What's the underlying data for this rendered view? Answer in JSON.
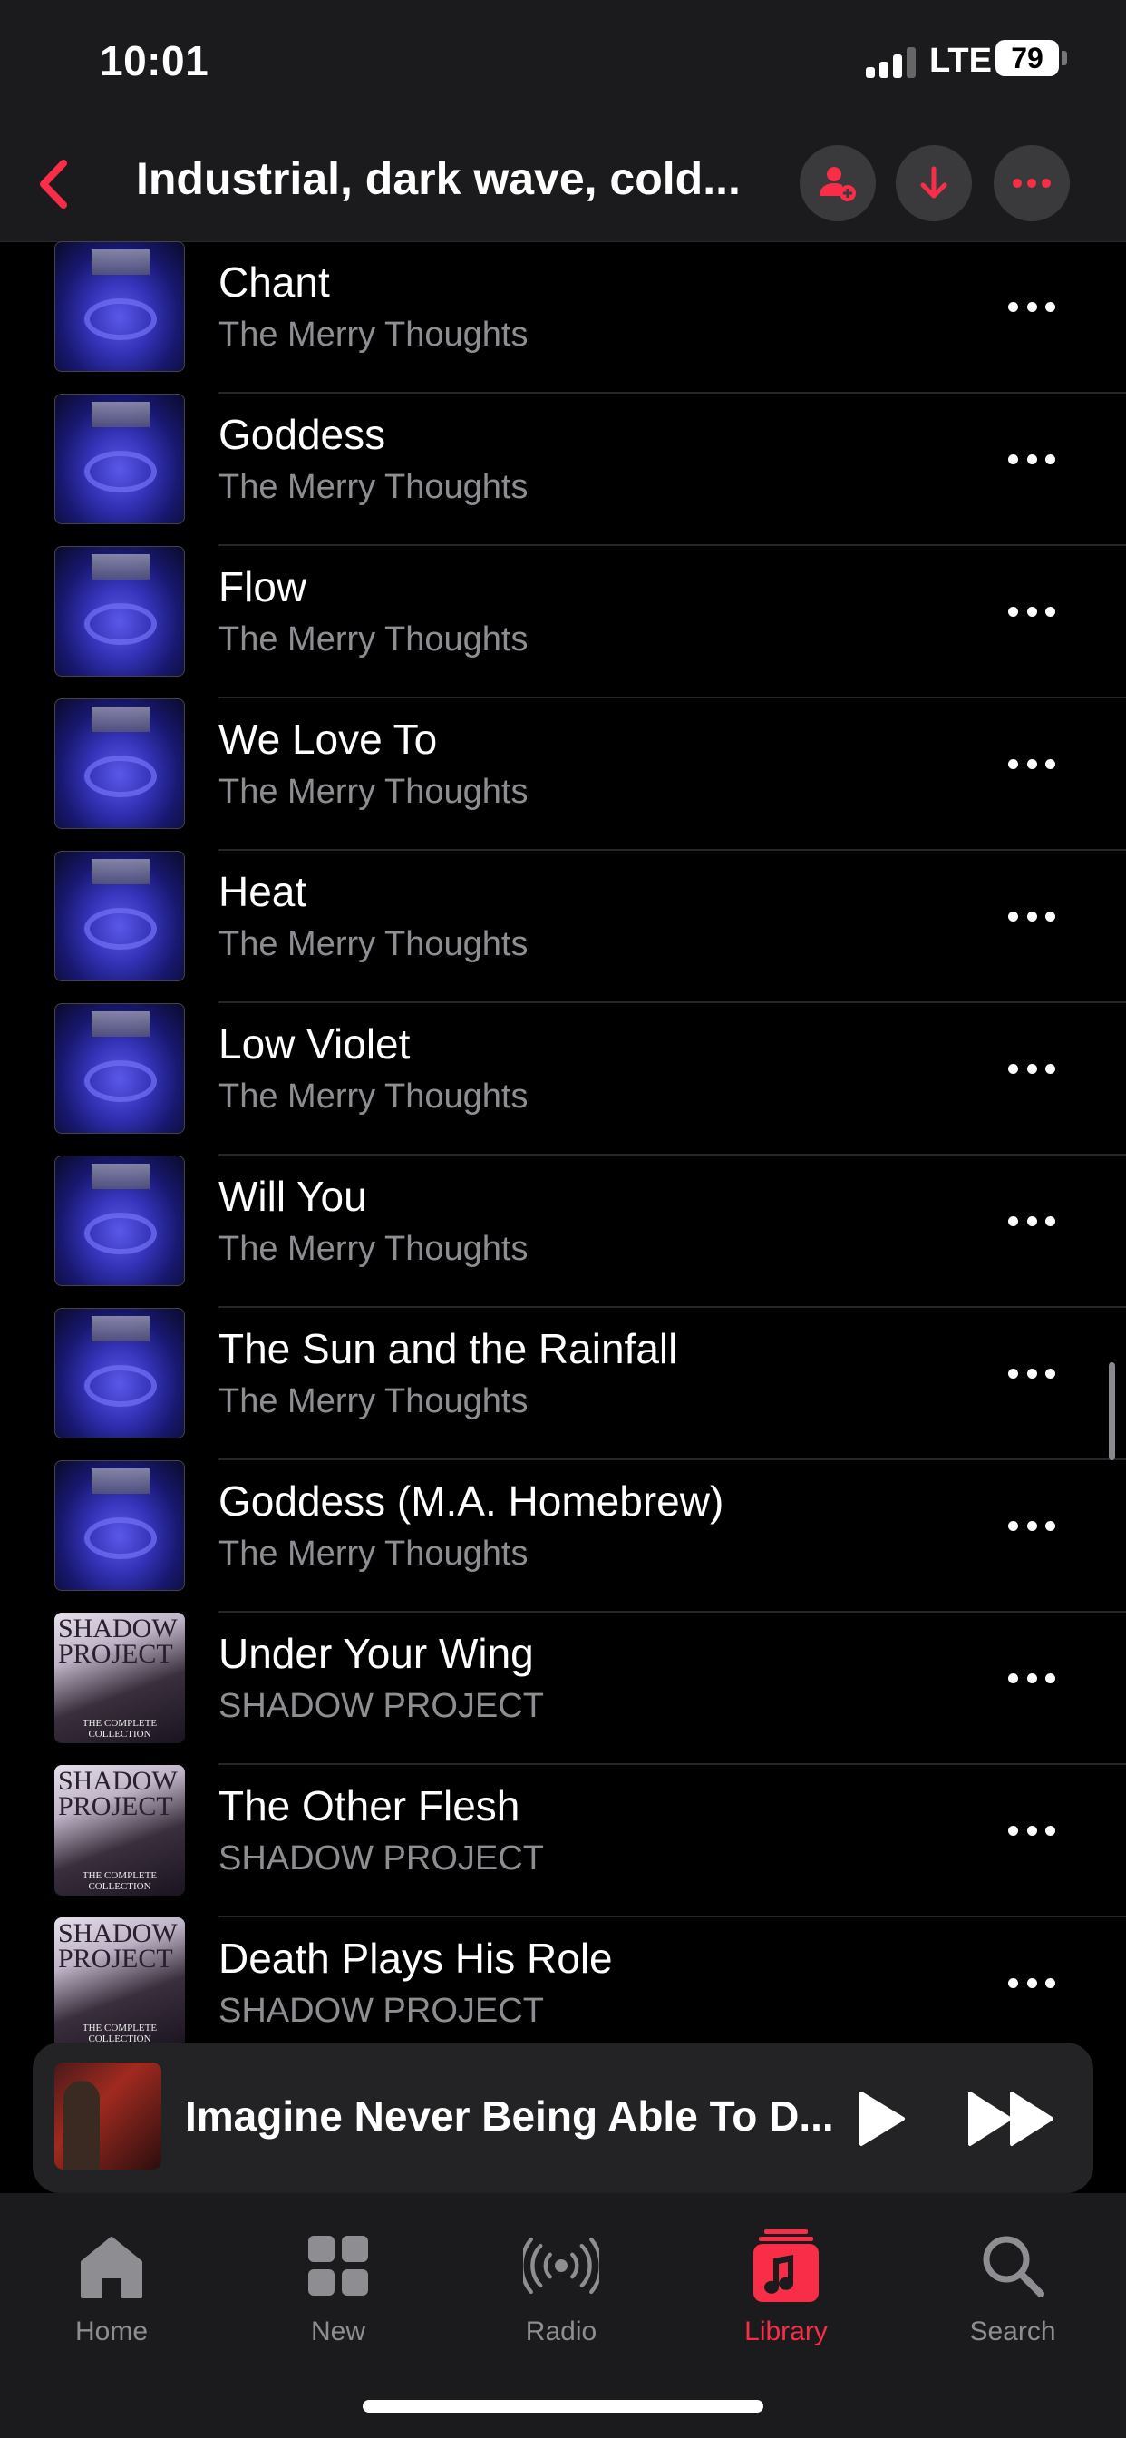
{
  "status_bar": {
    "time": "10:01",
    "network": "LTE",
    "battery": "79"
  },
  "header": {
    "title": "Industrial, dark wave, cold..."
  },
  "songs": [
    {
      "title": "Chant",
      "artist": "The Merry Thoughts"
    },
    {
      "title": "Goddess",
      "artist": "The Merry Thoughts"
    },
    {
      "title": "Flow",
      "artist": "The Merry Thoughts"
    },
    {
      "title": "We Love To",
      "artist": "The Merry Thoughts"
    },
    {
      "title": "Heat",
      "artist": "The Merry Thoughts"
    },
    {
      "title": "Low Violet",
      "artist": "The Merry Thoughts"
    },
    {
      "title": "Will You",
      "artist": "The Merry Thoughts"
    },
    {
      "title": "The Sun and the Rainfall",
      "artist": "The Merry Thoughts"
    },
    {
      "title": "Goddess (M.A. Homebrew)",
      "artist": "The Merry Thoughts"
    },
    {
      "title": "Under Your Wing",
      "artist": "SHADOW PROJECT"
    },
    {
      "title": "The Other Flesh",
      "artist": "SHADOW PROJECT"
    },
    {
      "title": "Death Plays His Role",
      "artist": "SHADOW PROJECT"
    }
  ],
  "album_art": {
    "shadow_text": "SHADOW PROJECT",
    "shadow_footer": "THE COMPLETE COLLECTION"
  },
  "now_playing": {
    "title": "Imagine Never Being Able To D..."
  },
  "tabs": [
    {
      "label": "Home",
      "icon": "house-icon"
    },
    {
      "label": "New",
      "icon": "grid-icon"
    },
    {
      "label": "Radio",
      "icon": "radio-icon"
    },
    {
      "label": "Library",
      "icon": "music-note-icon",
      "active": true
    },
    {
      "label": "Search",
      "icon": "magnifier-icon"
    }
  ],
  "colors": {
    "accent": "#fa2d48",
    "secondary_text": "#8d8d92",
    "bar_bg": "#1b1b1d"
  }
}
